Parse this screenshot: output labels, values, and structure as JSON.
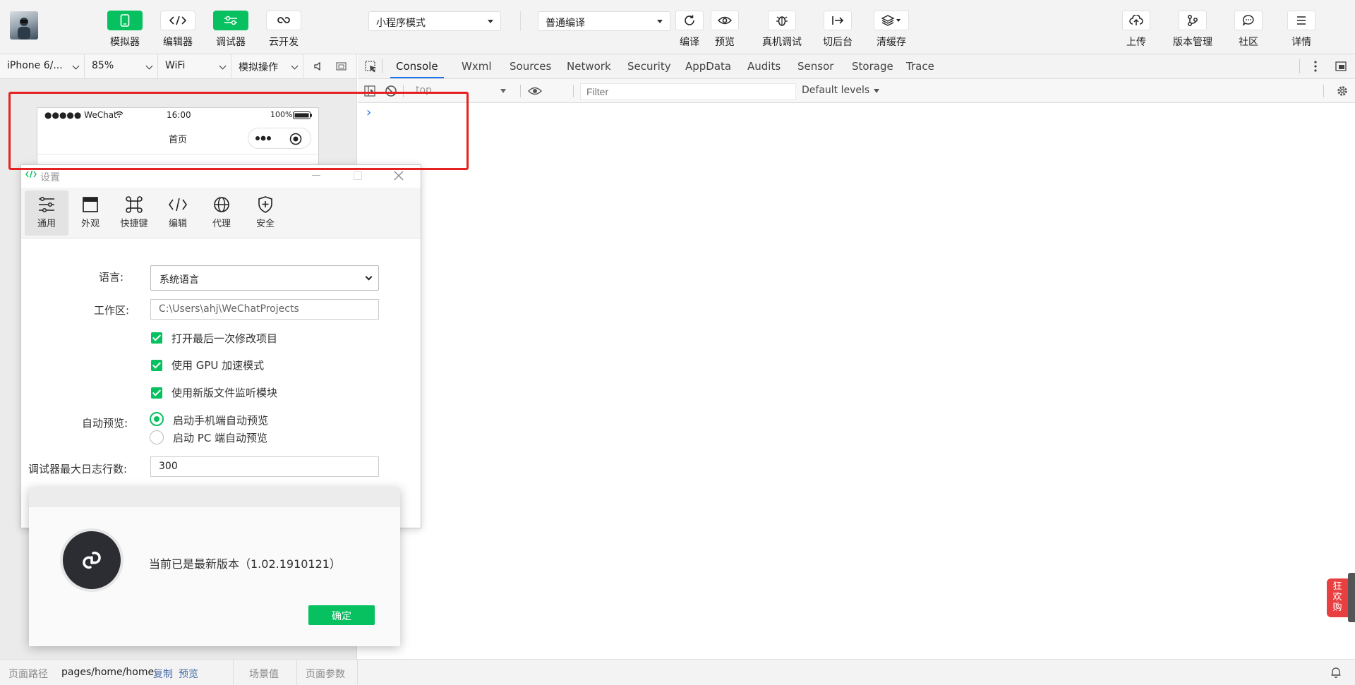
{
  "toolbar": {
    "left_buttons": [
      {
        "label": "模拟器",
        "icon": "phone-icon"
      },
      {
        "label": "编辑器",
        "icon": "code-icon"
      },
      {
        "label": "调试器",
        "icon": "toggle-icon"
      },
      {
        "label": "云开发",
        "icon": "cloud-link-icon"
      }
    ],
    "mode_select": "小程序模式",
    "compile_select": "普通编译",
    "middle_buttons": [
      {
        "label": "编译",
        "icon": "refresh-icon"
      },
      {
        "label": "预览",
        "icon": "eye-icon"
      },
      {
        "label": "真机调试",
        "icon": "bug-icon"
      },
      {
        "label": "切后台",
        "icon": "switch-icon"
      },
      {
        "label": "清缓存",
        "icon": "layers-icon"
      }
    ],
    "right_buttons": [
      {
        "label": "上传",
        "icon": "upload-icon"
      },
      {
        "label": "版本管理",
        "icon": "branch-icon"
      },
      {
        "label": "社区",
        "icon": "chat-icon"
      },
      {
        "label": "详情",
        "icon": "menu-icon"
      }
    ]
  },
  "simbar": {
    "device": "iPhone 6/...",
    "zoom": "85%",
    "network": "WiFi",
    "operation": "模拟操作"
  },
  "phone": {
    "carrier": "●●●●● WeChat",
    "time": "16:00",
    "battery": "100%",
    "title": "首页"
  },
  "devtools": {
    "tabs": [
      "Console",
      "Wxml",
      "Sources",
      "Network",
      "Security",
      "AppData",
      "Audits",
      "Sensor",
      "Storage",
      "Trace"
    ],
    "active_tab": "Console",
    "context": "top",
    "filter_placeholder": "Filter",
    "levels": "Default levels",
    "prompt": "›"
  },
  "settings": {
    "title": "设置",
    "tabs": [
      {
        "label": "通用",
        "icon": "sliders-icon"
      },
      {
        "label": "外观",
        "icon": "window-icon"
      },
      {
        "label": "快捷键",
        "icon": "command-icon"
      },
      {
        "label": "编辑",
        "icon": "code-icon"
      },
      {
        "label": "代理",
        "icon": "globe-icon"
      },
      {
        "label": "安全",
        "icon": "shield-icon"
      }
    ],
    "language_label": "语言:",
    "language_value": "系统语言",
    "workspace_label": "工作区:",
    "workspace_value": "C:\\Users\\ahj\\WeChatProjects",
    "checkboxes": [
      "打开最后一次修改项目",
      "使用 GPU 加速模式",
      "使用新版文件监听模块"
    ],
    "autopreview_label": "自动预览:",
    "radios": [
      "启动手机端自动预览",
      "启动 PC 端自动预览"
    ],
    "maxlog_label": "调试器最大日志行数:",
    "maxlog_value": "300"
  },
  "version_dialog": {
    "message": "当前已是最新版本（1.02.1910121）",
    "confirm": "确定"
  },
  "footer": {
    "path_label": "页面路径",
    "path_value": "pages/home/home",
    "copy": "复制",
    "preview": "预览",
    "scene": "场景值",
    "params": "页面参数"
  },
  "side_badge": "狂欢购"
}
